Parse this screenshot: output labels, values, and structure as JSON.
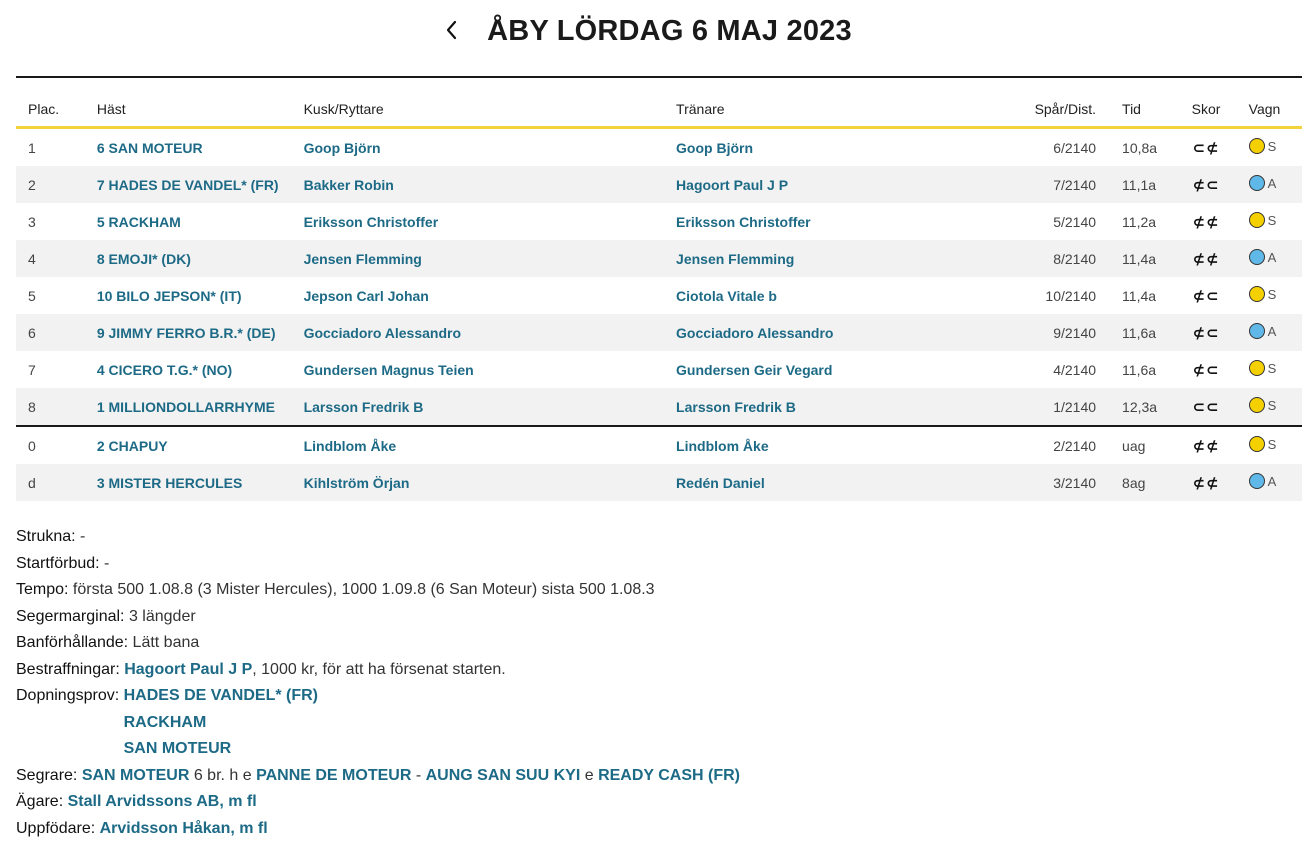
{
  "header": {
    "title": "ÅBY LÖRDAG 6 MAJ 2023"
  },
  "columns": {
    "plac": "Plac.",
    "hast": "Häst",
    "kusk": "Kusk/Ryttare",
    "tranare": "Tränare",
    "spar": "Spår/Dist.",
    "tid": "Tid",
    "skor": "Skor",
    "vagn": "Vagn"
  },
  "results": [
    {
      "plac": "1",
      "hast": "6 SAN MOTEUR",
      "kusk": "Goop Björn",
      "tranare": "Goop Björn",
      "spar": "6/2140",
      "tid": "10,8a",
      "skor": "⊂⊄",
      "vagn_color": "#f5d000",
      "vagn": "S"
    },
    {
      "plac": "2",
      "hast": "7 HADES DE VANDEL* (FR)",
      "kusk": "Bakker Robin",
      "tranare": "Hagoort Paul J P",
      "spar": "7/2140",
      "tid": "11,1a",
      "skor": "⊄⊂",
      "vagn_color": "#5fb8e8",
      "vagn": "A"
    },
    {
      "plac": "3",
      "hast": "5 RACKHAM",
      "kusk": "Eriksson Christoffer",
      "tranare": "Eriksson Christoffer",
      "spar": "5/2140",
      "tid": "11,2a",
      "skor": "⊄⊄",
      "vagn_color": "#f5d000",
      "vagn": "S"
    },
    {
      "plac": "4",
      "hast": "8 EMOJI* (DK)",
      "kusk": "Jensen Flemming",
      "tranare": "Jensen Flemming",
      "spar": "8/2140",
      "tid": "11,4a",
      "skor": "⊄⊄",
      "vagn_color": "#5fb8e8",
      "vagn": "A"
    },
    {
      "plac": "5",
      "hast": "10 BILO JEPSON* (IT)",
      "kusk": "Jepson Carl Johan",
      "tranare": "Ciotola Vitale b",
      "spar": "10/2140",
      "tid": "11,4a",
      "skor": "⊄⊂",
      "vagn_color": "#f5d000",
      "vagn": "S"
    },
    {
      "plac": "6",
      "hast": "9 JIMMY FERRO B.R.* (DE)",
      "kusk": "Gocciadoro Alessandro",
      "tranare": "Gocciadoro Alessandro",
      "spar": "9/2140",
      "tid": "11,6a",
      "skor": "⊄⊂",
      "vagn_color": "#5fb8e8",
      "vagn": "A"
    },
    {
      "plac": "7",
      "hast": "4 CICERO T.G.* (NO)",
      "kusk": "Gundersen Magnus Teien",
      "tranare": "Gundersen Geir Vegard",
      "spar": "4/2140",
      "tid": "11,6a",
      "skor": "⊄⊂",
      "vagn_color": "#f5d000",
      "vagn": "S"
    },
    {
      "plac": "8",
      "hast": "1 MILLIONDOLLARRHYME",
      "kusk": "Larsson Fredrik B",
      "tranare": "Larsson Fredrik B",
      "spar": "1/2140",
      "tid": "12,3a",
      "skor": "⊂⊂",
      "vagn_color": "#f5d000",
      "vagn": "S"
    },
    {
      "plac": "0",
      "hast": "2 CHAPUY",
      "kusk": "Lindblom Åke",
      "tranare": "Lindblom Åke",
      "spar": "2/2140",
      "tid": "uag",
      "skor": "⊄⊄",
      "vagn_color": "#f5d000",
      "vagn": "S"
    },
    {
      "plac": "d",
      "hast": "3 MISTER HERCULES",
      "kusk": "Kihlström Örjan",
      "tranare": "Redén Daniel",
      "spar": "3/2140",
      "tid": "8ag",
      "skor": "⊄⊄",
      "vagn_color": "#5fb8e8",
      "vagn": "A"
    }
  ],
  "info": {
    "strukna_label": "Strukna:",
    "strukna": " -",
    "startforbud_label": "Startförbud:",
    "startforbud": " -",
    "tempo_label": "Tempo:",
    "tempo": " första 500 1.08.8 (3 Mister Hercules), 1000 1.09.8 (6 San Moteur) sista 500 1.08.3",
    "segermarginal_label": "Segermarginal:",
    "segermarginal": " 3 längder",
    "banforhallande_label": "Banförhållande:",
    "banforhallande": " Lätt bana",
    "bestraffningar_label": "Bestraffningar:",
    "bestraffningar_link": "Hagoort Paul J P",
    "bestraffningar_text": ", 1000 kr, för att ha försenat starten.",
    "dopningsprov_label": "Dopningsprov:",
    "dopningsprov": [
      "HADES DE VANDEL* (FR)",
      "RACKHAM",
      "SAN MOTEUR"
    ],
    "segrare_label": "Segrare:",
    "segrare_horse": "SAN MOTEUR",
    "segrare_desc": " 6 br. h e ",
    "segrare_sire": "PANNE DE MOTEUR",
    "segrare_dash": " - ",
    "segrare_dam": "AUNG SAN SUU KYI",
    "segrare_e": " e ",
    "segrare_damsire": "READY CASH (FR)",
    "agare_label": "Ägare:",
    "agare": "Stall Arvidssons AB, m fl",
    "uppfodare_label": "Uppfödare:",
    "uppfodare": "Arvidsson Håkan, m fl"
  }
}
